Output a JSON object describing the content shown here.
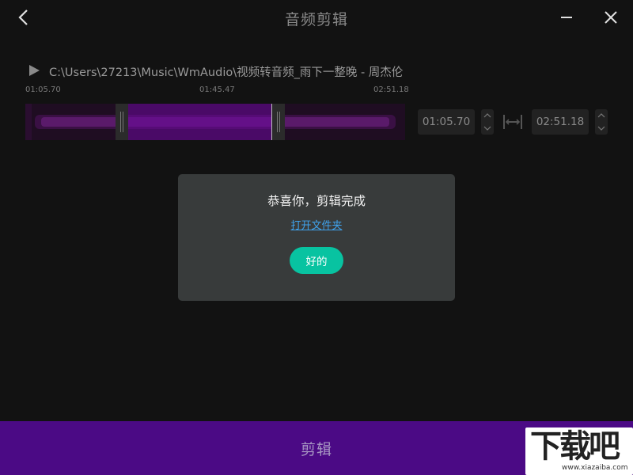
{
  "header": {
    "title": "音频剪辑",
    "back_icon": "chevron-left-icon",
    "minimize_icon": "minimize-icon",
    "close_icon": "close-icon"
  },
  "player": {
    "play_icon": "play-icon",
    "file_path": "C:\\Users\\27213\\Music\\WmAudio\\视频转音频_雨下一整晚 - 周杰伦"
  },
  "timeline": {
    "label_start": "01:05.70",
    "label_mid": "01:45.47",
    "label_end": "02:51.18"
  },
  "trim": {
    "start_value": "01:05.70",
    "end_value": "02:51.18",
    "link_icon": "link-range-icon"
  },
  "dialog": {
    "title": "恭喜你，剪辑完成",
    "open_folder_label": "打开文件夹",
    "ok_label": "好的"
  },
  "action": {
    "label": "剪辑"
  },
  "watermark": {
    "main": "下载吧",
    "sub": "www.xiazaiba.com"
  },
  "colors": {
    "background": "#121212",
    "accent_purple": "#4b0a85",
    "waveform": "#6e0aa0",
    "ok_button": "#08c3a1",
    "link": "#3fa2ec",
    "dialog_bg": "#383b3b"
  }
}
